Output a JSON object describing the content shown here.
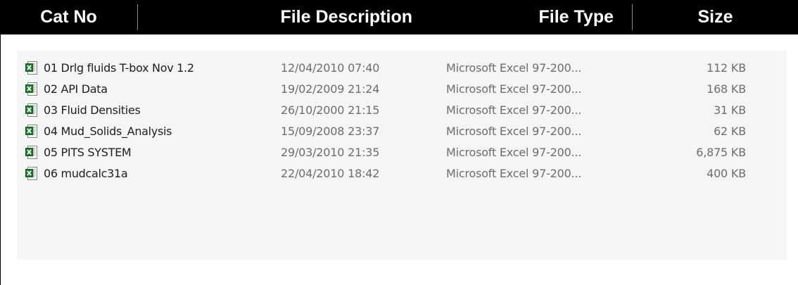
{
  "header": {
    "columns": [
      "Cat No",
      "File Description",
      "File Type",
      "Size"
    ]
  },
  "files": [
    {
      "name": "01 Drlg fluids T-box Nov 1.2",
      "date": "12/04/2010 07:40",
      "type": "Microsoft Excel 97-200...",
      "size": "112 KB",
      "icon": "excel-file-icon"
    },
    {
      "name": "02 API Data",
      "date": "19/02/2009 21:24",
      "type": "Microsoft Excel 97-200...",
      "size": "168 KB",
      "icon": "excel-file-icon"
    },
    {
      "name": "03 Fluid Densities",
      "date": "26/10/2000 21:15",
      "type": "Microsoft Excel 97-200...",
      "size": "31 KB",
      "icon": "excel-file-icon"
    },
    {
      "name": "04 Mud_Solids_Analysis",
      "date": "15/09/2008 23:37",
      "type": "Microsoft Excel 97-200...",
      "size": "62 KB",
      "icon": "excel-file-icon"
    },
    {
      "name": "05 PITS SYSTEM",
      "date": "29/03/2010 21:35",
      "type": "Microsoft Excel 97-200...",
      "size": "6,875 KB",
      "icon": "excel-file-icon"
    },
    {
      "name": "06 mudcalc31a",
      "date": "22/04/2010 18:42",
      "type": "Microsoft Excel 97-200...",
      "size": "400 KB",
      "icon": "excel-file-icon"
    }
  ]
}
